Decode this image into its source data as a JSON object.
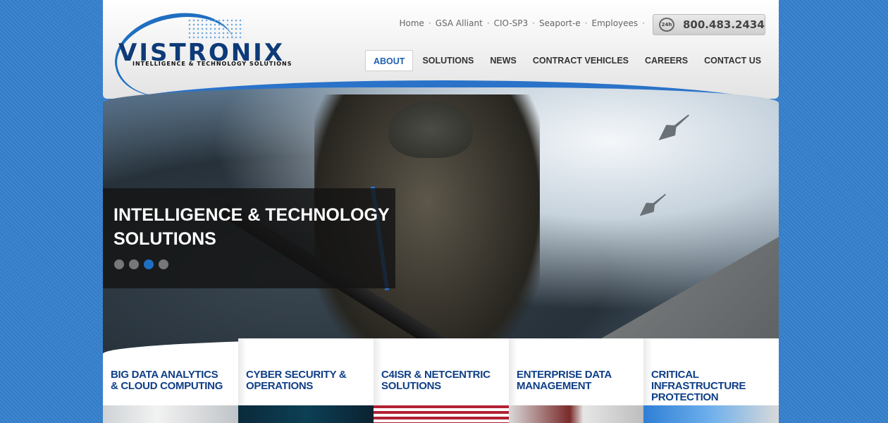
{
  "logo": {
    "name": "VISTRONIX",
    "tagline": "INTELLIGENCE & TECHNOLOGY SOLUTIONS"
  },
  "top_links": [
    "Home",
    "GSA Alliant",
    "CIO-SP3",
    "Seaport-e",
    "Employees"
  ],
  "top_link_separator": "·",
  "phone": {
    "badge": "24h",
    "number": "800.483.2434"
  },
  "nav": [
    {
      "label": "ABOUT",
      "active": true
    },
    {
      "label": "SOLUTIONS",
      "active": false
    },
    {
      "label": "NEWS",
      "active": false
    },
    {
      "label": "CONTRACT VEHICLES",
      "active": false
    },
    {
      "label": "CAREERS",
      "active": false
    },
    {
      "label": "CONTACT US",
      "active": false
    }
  ],
  "hero": {
    "caption_line1": "INTELLIGENCE & TECHNOLOGY",
    "caption_line2": "SOLUTIONS",
    "slides": 4,
    "active_slide": 3
  },
  "features": [
    {
      "line1": "BIG DATA ANALYTICS",
      "line2": "& CLOUD COMPUTING"
    },
    {
      "line1": "CYBER SECURITY &",
      "line2": "OPERATIONS"
    },
    {
      "line1": "C4ISR & NETCENTRIC",
      "line2": "SOLUTIONS"
    },
    {
      "line1": "ENTERPRISE DATA",
      "line2": "MANAGEMENT"
    },
    {
      "line1": "CRITICAL INFRASTRUCTURE",
      "line2": "PROTECTION"
    }
  ],
  "colors": {
    "brand_blue": "#1f6fc1",
    "navy": "#0f3f86",
    "background": "#3d86cf"
  }
}
